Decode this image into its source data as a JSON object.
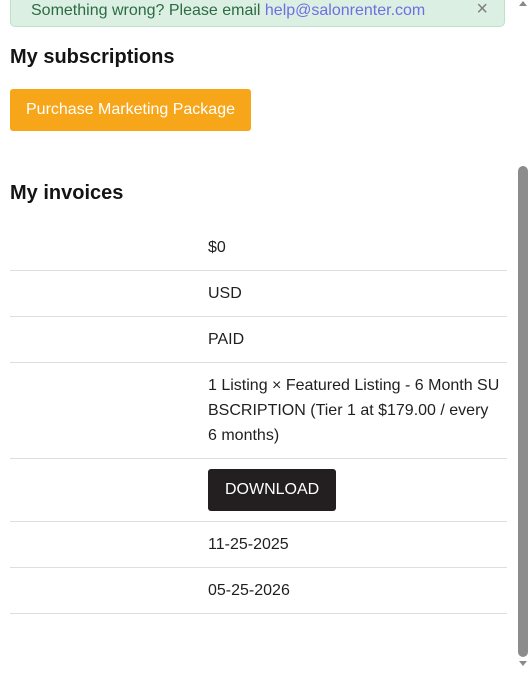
{
  "alert": {
    "text": "Something wrong? Please email ",
    "email": "help@salonrenter.com",
    "close_symbol": "×"
  },
  "subscriptions": {
    "heading": "My subscriptions",
    "purchase_button": "Purchase Marketing Package"
  },
  "invoices": {
    "heading": "My invoices",
    "amount": "$0",
    "currency": "USD",
    "status": "PAID",
    "description": "1 Listing × Featured Listing - 6 Month SUBSCRIPTION (Tier 1 at $179.00 / every 6 months)",
    "download_button": "DOWNLOAD",
    "period_start": "11-25-2025",
    "period_end": "05-25-2026"
  },
  "colors": {
    "accent_orange": "#f8a619",
    "download_dark": "#231f20",
    "alert_bg": "#dcefe3",
    "alert_text": "#2c6b44",
    "link": "#6f6fe0"
  }
}
